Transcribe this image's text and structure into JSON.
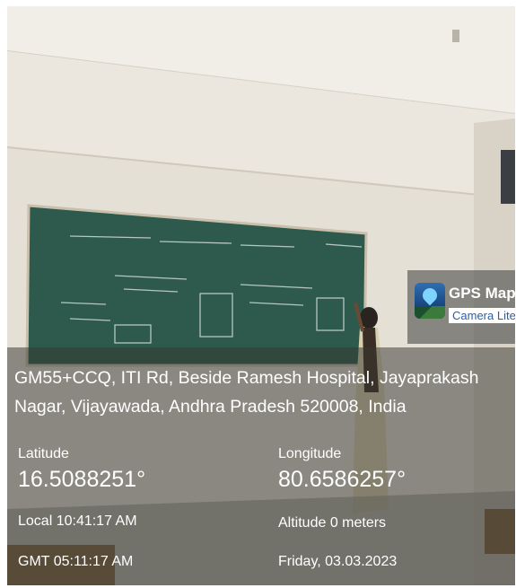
{
  "app": {
    "name": "GPS Map",
    "subtitle": "Camera Lite"
  },
  "location": {
    "address": "GM55+CCQ, ITI Rd, Beside Ramesh Hospital, Jayaprakash Nagar, Vijayawada, Andhra Pradesh 520008, India",
    "latitude_label": "Latitude",
    "latitude_value": "16.5088251°",
    "longitude_label": "Longitude",
    "longitude_value": "80.6586257°",
    "local_time": "Local 10:41:17 AM",
    "altitude": "Altitude 0 meters",
    "gmt_time": "GMT 05:11:17 AM",
    "date": "Friday, 03.03.2023"
  },
  "colors": {
    "chalkboard": "#2d5a4c",
    "wall": "#e9e6de",
    "overlay": "#37372f",
    "accent_blue": "#2a5fa8"
  },
  "icons": {
    "gps_app_icon": "gps-map-app-icon"
  }
}
